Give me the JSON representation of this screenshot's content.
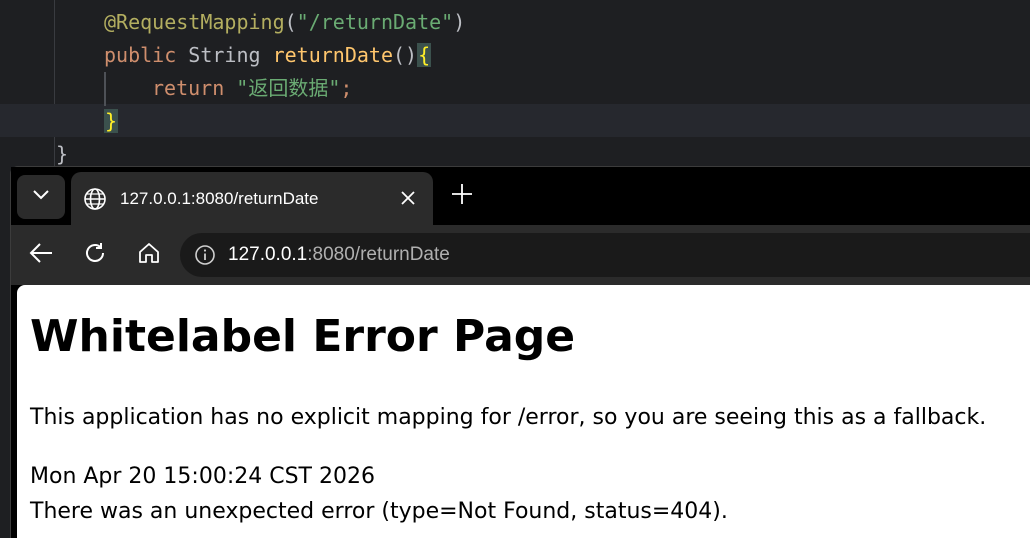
{
  "ide": {
    "annotation": "@RequestMapping",
    "paren_open": "(",
    "mapping_path": "\"/returnDate\"",
    "paren_close": ")",
    "kw_public": "public",
    "type_string": "String",
    "method_name": "returnDate",
    "parens": "()",
    "brace_open": "{",
    "kw_return": "return",
    "return_value": "\"返回数据\"",
    "semicolon": ";",
    "brace_close_method": "}",
    "brace_close_class": "}"
  },
  "browser": {
    "tab_title": "127.0.0.1:8080/returnDate",
    "url_host": "127.0.0.1",
    "url_rest": ":8080/returnDate",
    "icons": {
      "tab_list": "chevron-down-icon",
      "tab_favicon": "globe-icon",
      "tab_close": "close-icon",
      "new_tab": "plus-icon",
      "back": "back-arrow-icon",
      "refresh": "refresh-icon",
      "home": "home-icon",
      "site_info": "info-icon"
    }
  },
  "page": {
    "title": "Whitelabel Error Page",
    "message": "This application has no explicit mapping for /error, so you are seeing this as a fallback.",
    "timestamp": "Mon Apr 20 15:00:24 CST 2026",
    "error_detail": "There was an unexpected error (type=Not Found, status=404)."
  },
  "colors": {
    "ide_background": "#1e1f22",
    "annotation": "#b3ae60",
    "string": "#6aab73",
    "keyword": "#cf8e6d",
    "method": "#ffc66d",
    "browser_chrome": "#2b2b2b",
    "page_background": "#ffffff"
  }
}
